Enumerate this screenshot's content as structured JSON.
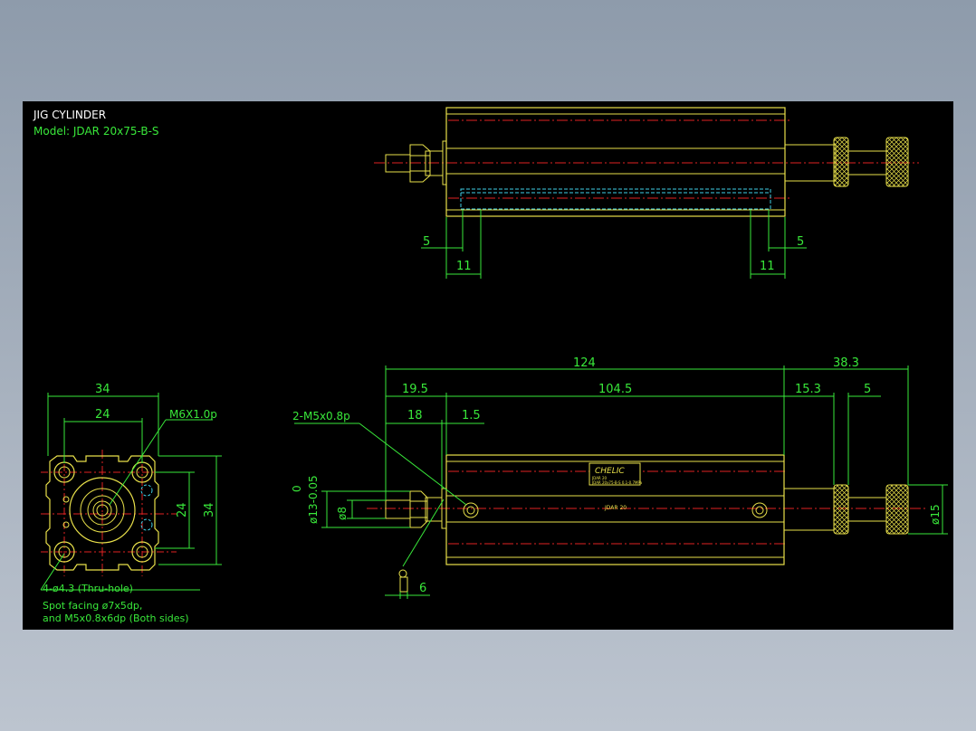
{
  "title": {
    "line1": "JIG CYLINDER",
    "line2": "Model:  JDAR 20x75-B-S"
  },
  "top_view": {
    "dims": {
      "left_5": "5",
      "left_11": "11",
      "right_5": "5",
      "right_11": "11"
    }
  },
  "front_view": {
    "dims": {
      "overall_width": "34",
      "bolt_spacing": "24",
      "thread_callout": "M6X1.0p",
      "vertical_24": "24",
      "vertical_34": "34"
    },
    "notes": {
      "holes": "4-ø4.3 (Thru-hole)",
      "spot_facing": "Spot facing ø7x5dp,",
      "threads": "and M5x0.8x6dp (Both sides)"
    }
  },
  "side_view": {
    "dims": {
      "total_length": "124",
      "rod_extension": "38.3",
      "front_offset": "19.5",
      "body_length": "104.5",
      "knob_offset": "15.3",
      "knob_width": "5",
      "port_offset": "18",
      "flange": "1.5",
      "port_callout": "2-M5x0.8p",
      "tol_upper": "0",
      "tol_lower": "ø13-0.05",
      "shaft_dia": "ø8",
      "knob_dia": "ø15",
      "bottom_6": "6"
    },
    "label": {
      "brand": "CHELIC",
      "line1": "JDAR 20",
      "line2": "JDAR 20x75-B-S 0.1-0.7MPa",
      "body_text": "JDAR 20"
    }
  },
  "colors": {
    "background": "#000000",
    "outline": "#e8e04a",
    "dimension": "#39e83a",
    "centerline": "#e02222",
    "hidden": "#3fd0e8",
    "text_white": "#ffffff"
  }
}
